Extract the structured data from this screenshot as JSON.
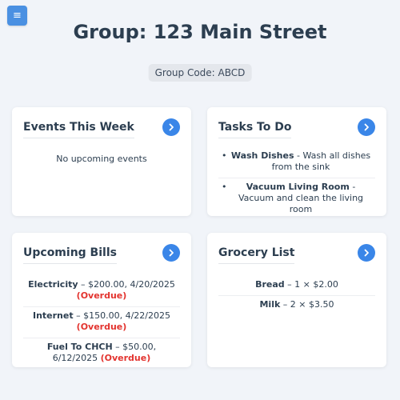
{
  "menu": {
    "icon": "hamburger-icon",
    "glyph": "≡"
  },
  "title": "Group: 123 Main Street",
  "group_code": "Group Code: ABCD",
  "events": {
    "title": "Events This Week",
    "empty_message": "No upcoming events"
  },
  "tasks": {
    "title": "Tasks To Do",
    "items": [
      {
        "name": "Wash Dishes",
        "description": " - Wash all dishes from the sink"
      },
      {
        "name": "Vacuum Living Room",
        "description": " - Vacuum and clean the living room"
      }
    ]
  },
  "bills": {
    "title": "Upcoming Bills",
    "items": [
      {
        "name": "Electricity",
        "details": " – $200.00, 4/20/2025 ",
        "status": "(Overdue)"
      },
      {
        "name": "Internet",
        "details": " – $150.00, 4/22/2025 ",
        "status": "(Overdue)"
      },
      {
        "name": "Fuel To CHCH",
        "details": " – $50.00, 6/12/2025 ",
        "status": "(Overdue)"
      }
    ]
  },
  "grocery": {
    "title": "Grocery List",
    "items": [
      {
        "name": "Bread",
        "details": " – 1 × $2.00"
      },
      {
        "name": "Milk",
        "details": " – 2 × $3.50"
      }
    ]
  },
  "colors": {
    "accent": "#3a86e8",
    "overdue": "#e3342f",
    "background": "#f1f4f9"
  }
}
